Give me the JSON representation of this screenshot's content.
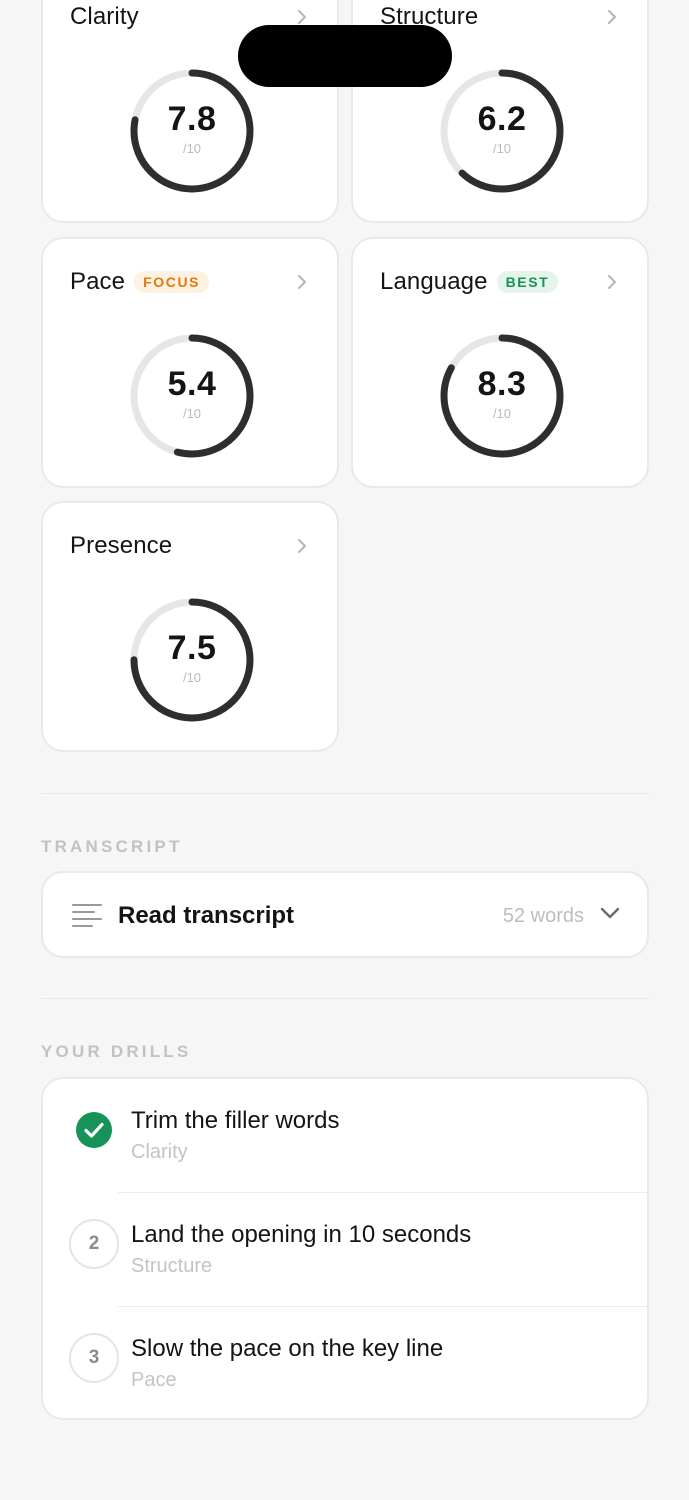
{
  "metrics": [
    {
      "title": "Clarity",
      "badge": "",
      "score": "7.8",
      "outof": "/10",
      "value": 7.8
    },
    {
      "title": "Structure",
      "badge": "",
      "score": "6.2",
      "outof": "/10",
      "value": 6.2
    },
    {
      "title": "Pace",
      "badge": "FOCUS",
      "score": "5.4",
      "outof": "/10",
      "value": 5.4
    },
    {
      "title": "Language",
      "badge": "BEST",
      "score": "8.3",
      "outof": "/10",
      "value": 8.3
    },
    {
      "title": "Presence",
      "badge": "",
      "score": "7.5",
      "outof": "/10",
      "value": 7.5
    }
  ],
  "transcript": {
    "section_label": "TRANSCRIPT",
    "label": "Read transcript",
    "count": "52 words"
  },
  "drills": {
    "section_label": "YOUR DRILLS",
    "items": [
      {
        "marker": "",
        "done": true,
        "title": "Trim the filler words",
        "category": "Clarity"
      },
      {
        "marker": "2",
        "done": false,
        "title": "Land the opening in 10 seconds",
        "category": "Structure"
      },
      {
        "marker": "3",
        "done": false,
        "title": "Slow the pace on the key line",
        "category": "Pace"
      }
    ]
  },
  "colors": {
    "ring_track": "#e6e6e6",
    "ring_fill": "#2e2e2e",
    "check_green": "#17935a",
    "focus_badge": "#e07a10",
    "best_badge": "#17935a"
  }
}
